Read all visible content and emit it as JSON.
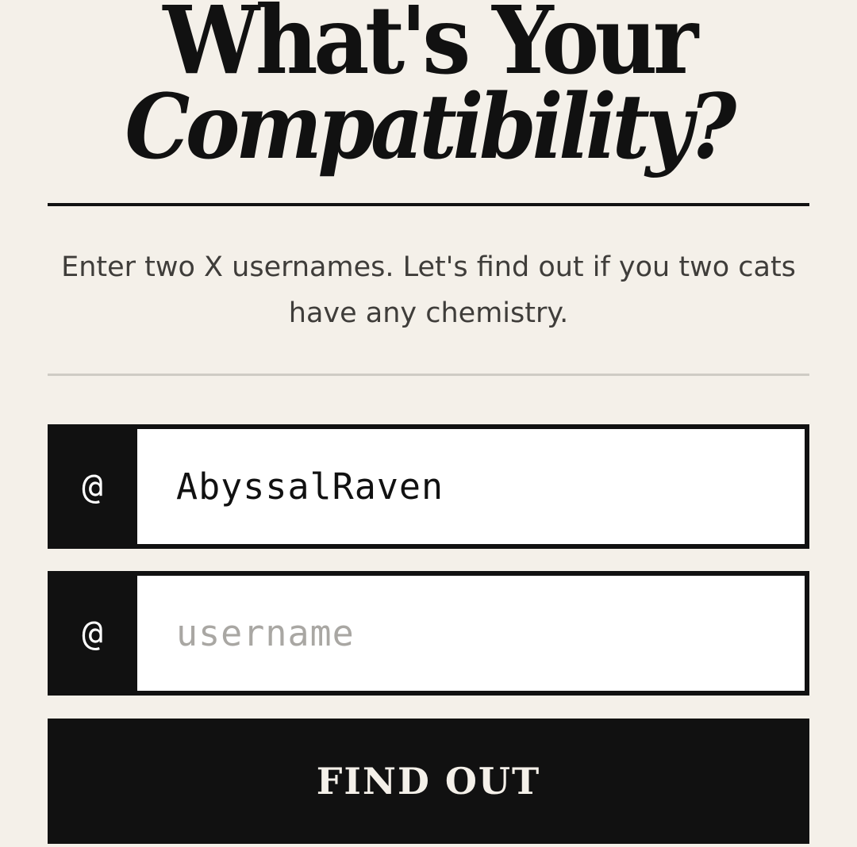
{
  "hero": {
    "title_line1": "What's Your",
    "title_line2": "Compatibility?"
  },
  "intro": {
    "text": "Enter two X usernames. Let's find out if you two cats have any chemistry."
  },
  "form": {
    "prefix": "@",
    "username1": {
      "value": "AbyssalRaven",
      "placeholder": "username"
    },
    "username2": {
      "value": "",
      "placeholder": "username"
    },
    "submit_label": "FIND OUT"
  },
  "colors": {
    "background": "#f4f0e9",
    "ink": "#111111",
    "muted_text": "#3f3d3a",
    "placeholder": "#a9a7a3",
    "divider": "#cfccc5"
  }
}
